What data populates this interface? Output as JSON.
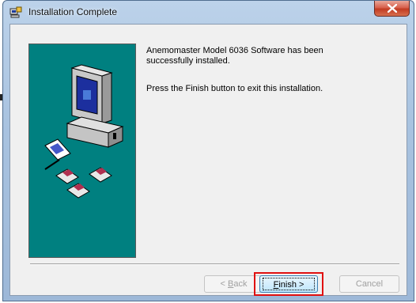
{
  "window": {
    "title": "Installation Complete",
    "close_label": "Close"
  },
  "main": {
    "message_line1": "Anemomaster Model 6036 Software has been",
    "message_line2": "successfully installed.",
    "message_finish": "Press the Finish button to exit this installation."
  },
  "buttons": {
    "back": {
      "prefix": "< ",
      "accel": "B",
      "rest": "ack",
      "enabled": false
    },
    "finish": {
      "accel": "F",
      "rest": "inish >",
      "enabled": true
    },
    "cancel": {
      "label": "Cancel",
      "enabled": false
    }
  },
  "colors": {
    "banner": "#008080",
    "highlight": "#e01010"
  }
}
